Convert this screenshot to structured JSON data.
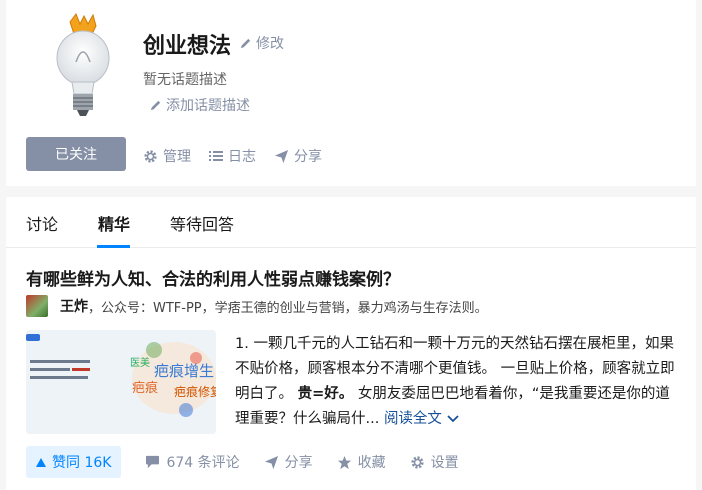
{
  "topic": {
    "title": "创业想法",
    "edit_label": "修改",
    "description": "暂无话题描述",
    "add_description_label": "添加话题描述",
    "follow_label": "已关注",
    "actions": {
      "manage": "管理",
      "log": "日志",
      "share": "分享"
    }
  },
  "tabs": [
    {
      "label": "讨论"
    },
    {
      "label": "精华",
      "active": true
    },
    {
      "label": "等待回答"
    }
  ],
  "answer": {
    "question_title": "有哪些鲜为人知、合法的利用人性弱点赚钱案例？",
    "author_name": "王炸",
    "author_bio": "，公众号：WTF-PP，学痞王德的创业与营销，暴力鸡汤与生存法则。",
    "excerpt_part1": "1. 一颗几千元的人工钻石和一颗十万元的天然钻石摆在展柜里，如果不贴价格，顾客根本分不清哪个更值钱。 一旦贴上价格，顾客就立即明白了。",
    "excerpt_bold": "贵=好。",
    "excerpt_part2": " 女朋友委屈巴巴地看着你，“是我重要还是你的道理重要？什么骗局什...",
    "read_more": "阅读全文",
    "thumbnail_words": [
      "疤痕增生",
      "疤痕",
      "疤痕修复",
      "医美"
    ],
    "vote_label": "赞同 16K",
    "comments_label": "674 条评论",
    "share_label": "分享",
    "favorite_label": "收藏",
    "settings_label": "设置"
  },
  "colors": {
    "accent": "#0084ff",
    "muted": "#8590a6",
    "follow_bg": "#8590a6",
    "vote_bg": "#e5f2ff"
  },
  "icons": [
    "lightbulb-icon",
    "pencil-icon",
    "gear-icon",
    "list-icon",
    "paper-plane-icon",
    "triangle-up-icon",
    "comment-icon",
    "star-icon",
    "chevron-down-icon"
  ]
}
